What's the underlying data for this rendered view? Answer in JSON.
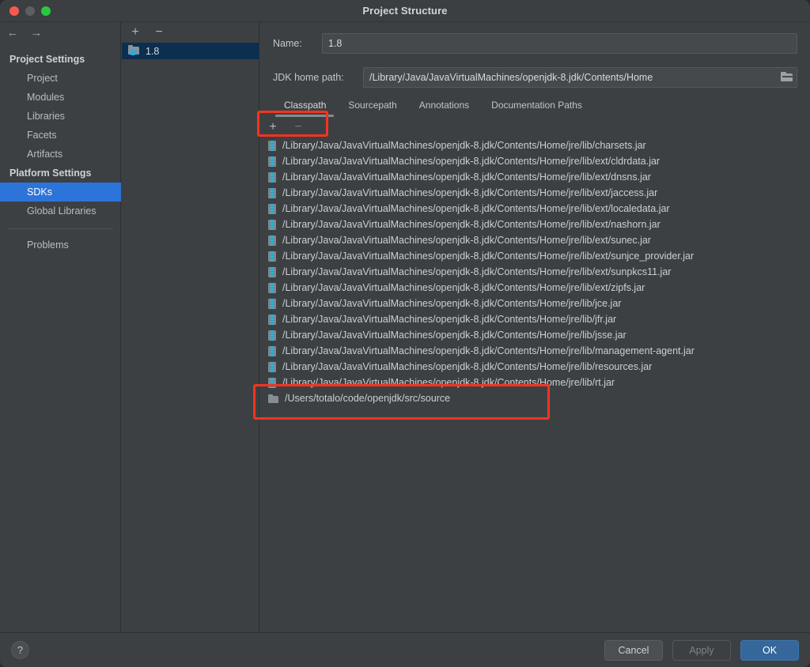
{
  "window": {
    "title": "Project Structure",
    "traffic_lights": [
      "close-red",
      "minimize-gray",
      "zoom-green"
    ]
  },
  "nav": {
    "back": "←",
    "forward": "→"
  },
  "sidebar": {
    "groups": [
      {
        "label": "Project Settings",
        "items": [
          {
            "label": "Project",
            "selected": false
          },
          {
            "label": "Modules",
            "selected": false
          },
          {
            "label": "Libraries",
            "selected": false
          },
          {
            "label": "Facets",
            "selected": false
          },
          {
            "label": "Artifacts",
            "selected": false
          }
        ]
      },
      {
        "label": "Platform Settings",
        "items": [
          {
            "label": "SDKs",
            "selected": true
          },
          {
            "label": "Global Libraries",
            "selected": false
          }
        ]
      }
    ],
    "extra_items": [
      {
        "label": "Problems",
        "selected": false
      }
    ]
  },
  "sdk_panel": {
    "toolbar": {
      "add": "+",
      "remove": "−"
    },
    "items": [
      {
        "label": "1.8",
        "selected": true,
        "icon": "jdk-folder-icon"
      }
    ]
  },
  "detail": {
    "name_label": "Name:",
    "name_value": "1.8",
    "path_label": "JDK home path:",
    "path_value": "/Library/Java/JavaVirtualMachines/openjdk-8.jdk/Contents/Home",
    "browse_icon": "folder-browse-icon",
    "tabs": [
      {
        "label": "Classpath",
        "active": true
      },
      {
        "label": "Sourcepath",
        "active": false
      },
      {
        "label": "Annotations",
        "active": false
      },
      {
        "label": "Documentation Paths",
        "active": false
      }
    ],
    "classpath_toolbar": {
      "add": "+",
      "remove": "−"
    },
    "classpath_entries": [
      {
        "path": "/Library/Java/JavaVirtualMachines/openjdk-8.jdk/Contents/Home/jre/lib/charsets.jar",
        "icon": "jar-icon"
      },
      {
        "path": "/Library/Java/JavaVirtualMachines/openjdk-8.jdk/Contents/Home/jre/lib/ext/cldrdata.jar",
        "icon": "jar-icon"
      },
      {
        "path": "/Library/Java/JavaVirtualMachines/openjdk-8.jdk/Contents/Home/jre/lib/ext/dnsns.jar",
        "icon": "jar-icon"
      },
      {
        "path": "/Library/Java/JavaVirtualMachines/openjdk-8.jdk/Contents/Home/jre/lib/ext/jaccess.jar",
        "icon": "jar-icon"
      },
      {
        "path": "/Library/Java/JavaVirtualMachines/openjdk-8.jdk/Contents/Home/jre/lib/ext/localedata.jar",
        "icon": "jar-icon"
      },
      {
        "path": "/Library/Java/JavaVirtualMachines/openjdk-8.jdk/Contents/Home/jre/lib/ext/nashorn.jar",
        "icon": "jar-icon"
      },
      {
        "path": "/Library/Java/JavaVirtualMachines/openjdk-8.jdk/Contents/Home/jre/lib/ext/sunec.jar",
        "icon": "jar-icon"
      },
      {
        "path": "/Library/Java/JavaVirtualMachines/openjdk-8.jdk/Contents/Home/jre/lib/ext/sunjce_provider.jar",
        "icon": "jar-icon"
      },
      {
        "path": "/Library/Java/JavaVirtualMachines/openjdk-8.jdk/Contents/Home/jre/lib/ext/sunpkcs11.jar",
        "icon": "jar-icon"
      },
      {
        "path": "/Library/Java/JavaVirtualMachines/openjdk-8.jdk/Contents/Home/jre/lib/ext/zipfs.jar",
        "icon": "jar-icon"
      },
      {
        "path": "/Library/Java/JavaVirtualMachines/openjdk-8.jdk/Contents/Home/jre/lib/jce.jar",
        "icon": "jar-icon"
      },
      {
        "path": "/Library/Java/JavaVirtualMachines/openjdk-8.jdk/Contents/Home/jre/lib/jfr.jar",
        "icon": "jar-icon"
      },
      {
        "path": "/Library/Java/JavaVirtualMachines/openjdk-8.jdk/Contents/Home/jre/lib/jsse.jar",
        "icon": "jar-icon"
      },
      {
        "path": "/Library/Java/JavaVirtualMachines/openjdk-8.jdk/Contents/Home/jre/lib/management-agent.jar",
        "icon": "jar-icon"
      },
      {
        "path": "/Library/Java/JavaVirtualMachines/openjdk-8.jdk/Contents/Home/jre/lib/resources.jar",
        "icon": "jar-icon"
      },
      {
        "path": "/Library/Java/JavaVirtualMachines/openjdk-8.jdk/Contents/Home/jre/lib/rt.jar",
        "icon": "jar-icon"
      },
      {
        "path": "/Users/totalo/code/openjdk/src/source",
        "icon": "folder-icon"
      }
    ]
  },
  "footer": {
    "help": "?",
    "cancel": "Cancel",
    "apply": "Apply",
    "ok": "OK"
  },
  "annotations": {
    "accent_color": "#f5341f",
    "regions": [
      {
        "name": "classpath-toolbar-highlight"
      },
      {
        "name": "source-path-highlight"
      }
    ]
  }
}
